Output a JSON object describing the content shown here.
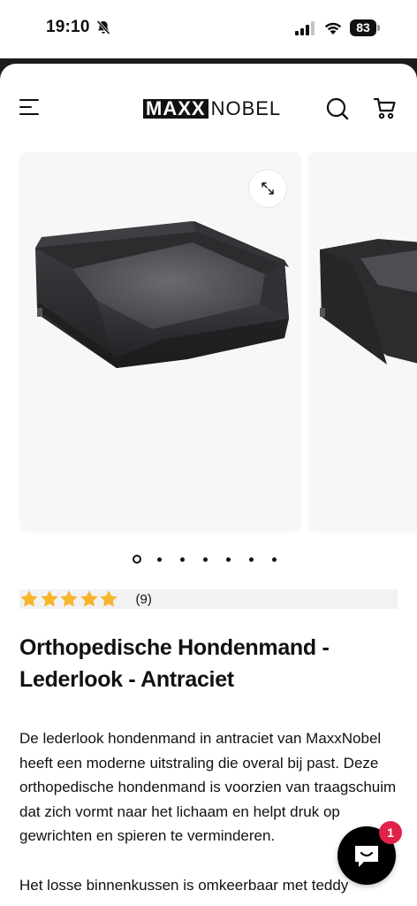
{
  "status_bar": {
    "time": "19:10",
    "battery": "83"
  },
  "header": {
    "logo_bold": "MAXX",
    "logo_light": "NOBEL",
    "icons": [
      "menu-icon",
      "search-icon",
      "cart-icon"
    ]
  },
  "gallery": {
    "slide_count": 7,
    "active_slide": 1
  },
  "rating": {
    "stars": 5,
    "count_label": "(9)",
    "star_color": "#f7b52c"
  },
  "product": {
    "title": "Orthopedische Hondenmand - Lederlook - Antraciet",
    "description_1": "De lederlook hondenmand in antraciet van MaxxNobel heeft een moderne uitstraling die overal bij past. Deze orthopedische hondenmand is voorzien van traagschuim dat zich vormt naar het lichaam en helpt druk op gewrichten en spieren te verminderen.",
    "description_2": "Het losse binnenkussen is omkeerbaar met teddy"
  },
  "chat": {
    "badge": "1"
  }
}
